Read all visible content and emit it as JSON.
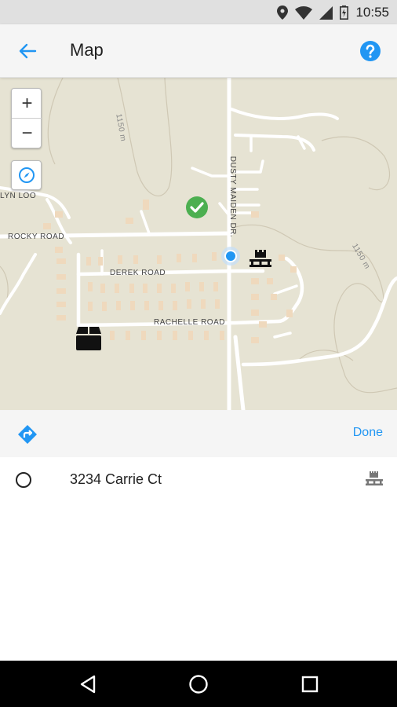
{
  "status_bar": {
    "time": "10:55",
    "icons": [
      "location-icon",
      "wifi-icon",
      "signal-icon",
      "battery-icon"
    ]
  },
  "app_bar": {
    "title": "Map",
    "back_icon": "arrow-left-icon",
    "help_icon": "help-circle-icon"
  },
  "map": {
    "zoom_in_label": "+",
    "zoom_out_label": "−",
    "compass_icon": "compass-icon",
    "street_labels": {
      "rocky_road": "ROCKY ROAD",
      "derek_road": "DEREK ROAD",
      "rachelle_road": "RACHELLE ROAD",
      "dusty_maiden": "DUSTY MAIDEN DR.",
      "lyn_loop": "LYN LOO",
      "contour_left": "1150 m",
      "contour_right": "1150 m"
    },
    "markers": [
      "check-marker-icon",
      "current-location-icon",
      "pallet-marker-icon",
      "package-marker-icon"
    ]
  },
  "route_bar": {
    "route_icon": "directions-icon",
    "done_label": "Done"
  },
  "list": {
    "items": [
      {
        "address": "3234 Carrie Ct",
        "icon": "pallet-icon",
        "checked": false
      }
    ]
  },
  "nav_bar": {
    "buttons": [
      "back-triangle-icon",
      "home-circle-icon",
      "recents-square-icon"
    ]
  },
  "colors": {
    "accent": "#2196f3",
    "map_bg": "#e6e3d3",
    "road": "#ffffff",
    "building": "#efd9bd",
    "check_green": "#4caf50"
  }
}
